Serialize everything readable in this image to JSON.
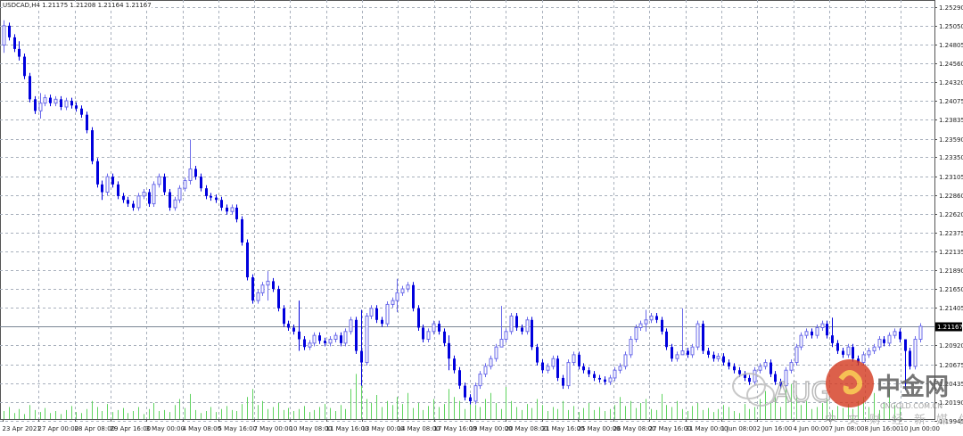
{
  "header": {
    "symbol": "USDCAD,H4",
    "open": "1.21175",
    "high": "1.21208",
    "low": "1.21164",
    "close": "1.21167"
  },
  "watermark": {
    "left_text": "AUG",
    "brand_cn": "中金网",
    "brand_url": "CNGOLD.COM.CN",
    "slogan": "中文财经新媒体"
  },
  "colors": {
    "bear": "#0000dd",
    "bull": "#6a6aea",
    "volume": "#5fd35f",
    "grid": "#a8b0bc",
    "current_price_line": "#7a8594",
    "current_price_bg": "#000000"
  },
  "chart_data": {
    "type": "candlestick",
    "title": "USDCAD,H4 1.21175 1.21208 1.21164 1.21167",
    "ylim": [
      1.19945,
      1.2529
    ],
    "y_ticks": [
      "1.25290",
      "1.25050",
      "1.24805",
      "1.24560",
      "1.24320",
      "1.24075",
      "1.23835",
      "1.23590",
      "1.23350",
      "1.23105",
      "1.22860",
      "1.22620",
      "1.22375",
      "1.22135",
      "1.21890",
      "1.21650",
      "1.21405",
      "1.20920",
      "1.20675",
      "1.20435",
      "1.20190",
      "1.19945"
    ],
    "current_price": "1.21167",
    "x_labels": [
      "23 Apr 2021",
      "27 Apr 00:00",
      "28 Apr 08:00",
      "29 Apr 16:00",
      "3 May 00:00",
      "4 May 08:00",
      "5 May 16:00",
      "7 May 00:00",
      "10 May 08:00",
      "11 May 16:00",
      "13 May 00:00",
      "14 May 08:00",
      "17 May 16:00",
      "19 May 00:00",
      "20 May 08:00",
      "21 May 16:00",
      "25 May 00:00",
      "26 May 08:00",
      "27 May 16:00",
      "31 May 00:00",
      "1 Jun 08:00",
      "2 Jun 16:00",
      "4 Jun 00:00",
      "7 Jun 08:00",
      "8 Jun 16:00",
      "10 Jun 00:00"
    ],
    "first_open": 1.248,
    "closes": [
      1.2505,
      1.249,
      1.2475,
      1.2465,
      1.244,
      1.241,
      1.2395,
      1.2405,
      1.2412,
      1.2405,
      1.241,
      1.24,
      1.2408,
      1.2402,
      1.2398,
      1.239,
      1.237,
      1.233,
      1.23,
      1.229,
      1.231,
      1.23,
      1.2285,
      1.228,
      1.2275,
      1.227,
      1.2285,
      1.229,
      1.2275,
      1.23,
      1.231,
      1.229,
      1.227,
      1.228,
      1.2295,
      1.2305,
      1.232,
      1.231,
      1.2295,
      1.2285,
      1.2283,
      1.228,
      1.227,
      1.2265,
      1.227,
      1.2255,
      1.2225,
      1.218,
      1.215,
      1.216,
      1.217,
      1.2175,
      1.2165,
      1.214,
      1.212,
      1.2115,
      1.211,
      1.21,
      1.209,
      1.2095,
      1.2105,
      1.2098,
      1.2095,
      1.21,
      1.2105,
      1.2095,
      1.211,
      1.2125,
      1.2085,
      1.207,
      1.213,
      1.214,
      1.2125,
      1.212,
      1.2145,
      1.215,
      1.216,
      1.2165,
      1.217,
      1.214,
      1.2115,
      1.21,
      1.211,
      1.212,
      1.211,
      1.2095,
      1.2075,
      1.206,
      1.204,
      1.2025,
      1.202,
      1.204,
      1.2055,
      1.2065,
      1.2075,
      1.209,
      1.21,
      1.211,
      1.213,
      1.2115,
      1.211,
      1.2125,
      1.209,
      1.207,
      1.206,
      1.2065,
      1.2075,
      1.205,
      1.204,
      1.207,
      1.208,
      1.2065,
      1.206,
      1.2055,
      1.205,
      1.2048,
      1.2045,
      1.205,
      1.206,
      1.2065,
      1.208,
      1.21,
      1.2115,
      1.212,
      1.2125,
      1.213,
      1.2125,
      1.211,
      1.209,
      1.2075,
      1.208,
      1.2085,
      1.208,
      1.209,
      1.212,
      1.2085,
      1.208,
      1.2075,
      1.2078,
      1.207,
      1.2065,
      1.206,
      1.2055,
      1.205,
      1.2045,
      1.206,
      1.2065,
      1.207,
      1.2055,
      1.2045,
      1.204,
      1.206,
      1.207,
      1.209,
      1.2105,
      1.211,
      1.2105,
      1.2115,
      1.212,
      1.2105,
      1.2095,
      1.2085,
      1.208,
      1.209,
      1.2075,
      1.207,
      1.208,
      1.2085,
      1.209,
      1.21,
      1.2095,
      1.2105,
      1.211,
      1.21,
      1.2085,
      1.2065,
      1.21,
      1.21167
    ],
    "default_wick": 0.0004,
    "wick_overrides": {
      "0": [
        1.2512,
        1.247
      ],
      "3": [
        1.2485,
        1.246
      ],
      "7": [
        1.2418,
        1.2385
      ],
      "19": [
        1.2305,
        1.228
      ],
      "36": [
        1.2358,
        1.23
      ],
      "51": [
        1.2188,
        1.215
      ],
      "57": [
        1.215,
        1.2085
      ],
      "69": [
        1.2138,
        1.204
      ],
      "76": [
        1.2178,
        1.2135
      ],
      "86": [
        1.2105,
        1.206
      ],
      "96": [
        1.2143,
        1.2095
      ],
      "124": [
        1.2138,
        1.211
      ],
      "131": [
        1.214,
        1.208
      ],
      "160": [
        1.2128,
        1.209
      ],
      "174": [
        1.21,
        1.2035
      ]
    },
    "volumes": [
      8,
      12,
      6,
      10,
      5,
      14,
      9,
      7,
      11,
      6,
      8,
      5,
      9,
      13,
      7,
      6,
      10,
      18,
      12,
      8,
      15,
      7,
      9,
      11,
      6,
      8,
      12,
      5,
      10,
      16,
      8,
      9,
      7,
      14,
      20,
      11,
      25,
      9,
      6,
      8,
      12,
      7,
      10,
      13,
      9,
      8,
      15,
      22,
      30,
      14,
      18,
      10,
      12,
      16,
      9,
      11,
      8,
      10,
      13,
      7,
      9,
      12,
      15,
      11,
      8,
      14,
      10,
      30,
      45,
      80,
      20,
      16,
      24,
      12,
      18,
      14,
      22,
      15,
      26,
      11,
      16,
      9,
      13,
      20,
      12,
      15,
      30,
      22,
      18,
      10,
      24,
      14,
      12,
      20,
      26,
      16,
      10,
      32,
      18,
      12,
      9,
      15,
      11,
      20,
      14,
      8,
      12,
      10,
      18,
      9,
      13,
      7,
      11,
      16,
      9,
      12,
      8,
      10,
      14,
      22,
      13,
      18,
      11,
      16,
      20,
      10,
      9,
      25,
      14,
      12,
      18,
      10,
      8,
      13,
      16,
      9,
      11,
      7,
      10,
      14,
      12,
      8,
      6,
      15,
      10,
      12,
      20,
      28,
      16,
      22,
      12,
      30,
      35,
      24,
      14,
      18,
      10,
      12,
      16,
      20,
      9,
      13,
      11,
      15,
      10,
      18,
      22,
      12,
      26,
      9,
      16,
      30,
      14,
      11
    ],
    "xlabel": "",
    "ylabel": ""
  }
}
